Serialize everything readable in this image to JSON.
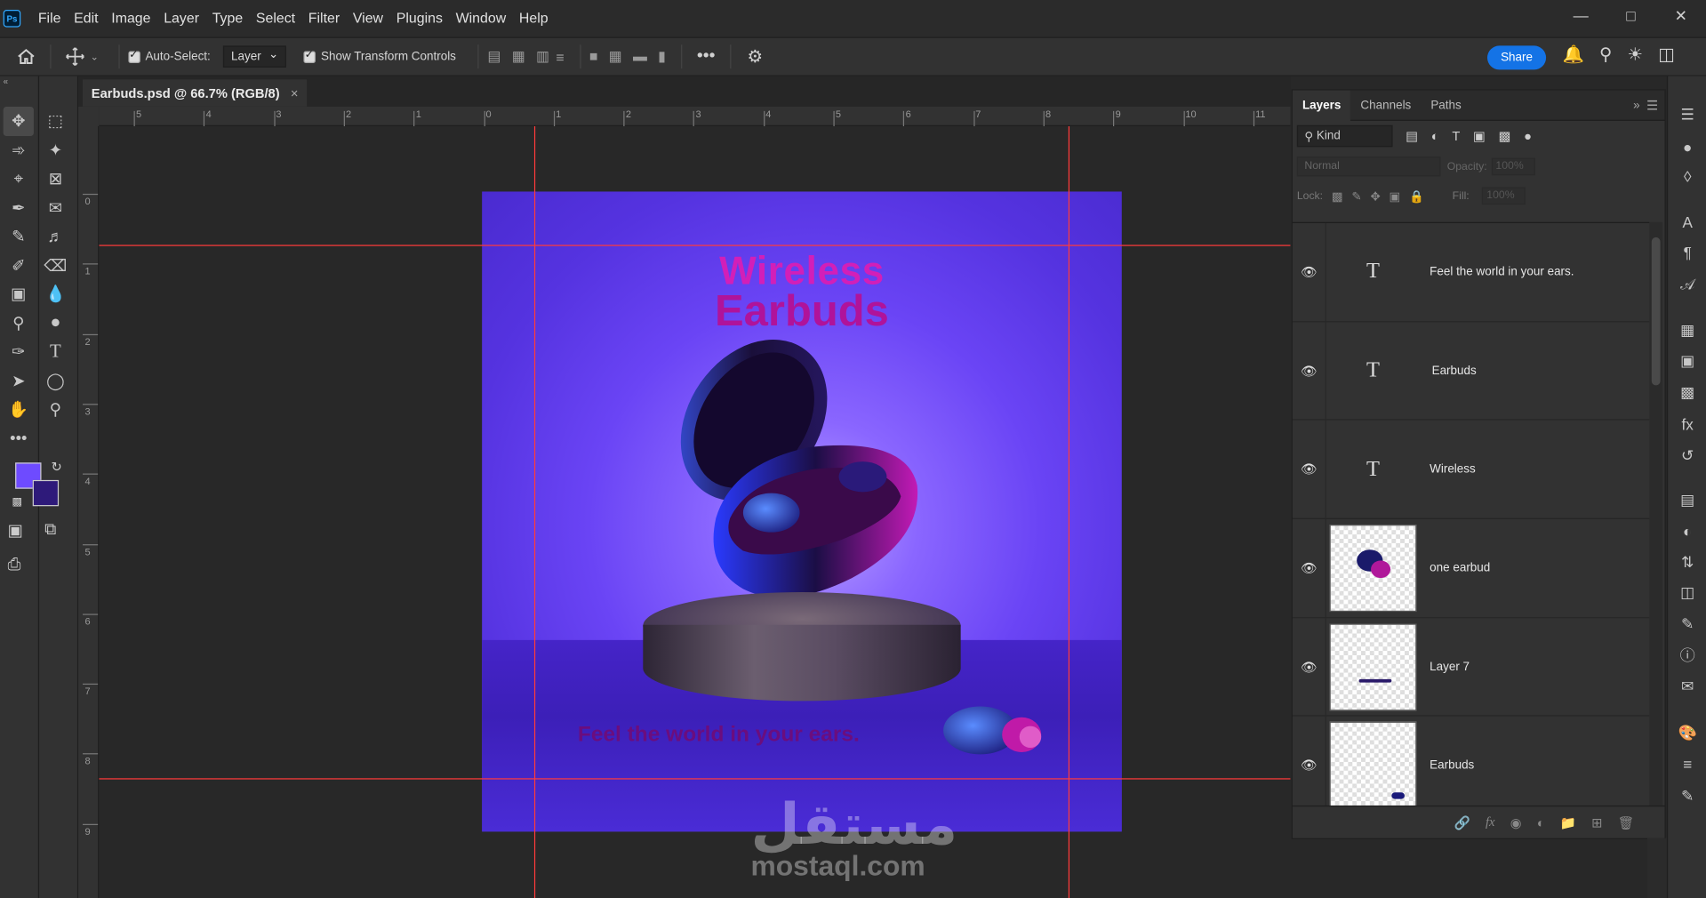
{
  "menubar": {
    "logo": "Ps",
    "items": [
      "File",
      "Edit",
      "Image",
      "Layer",
      "Type",
      "Select",
      "Filter",
      "View",
      "Plugins",
      "Window",
      "Help"
    ]
  },
  "options": {
    "auto_select_label": "Auto-Select:",
    "auto_select_value": "Layer",
    "show_transform_label": "Show Transform Controls",
    "share_label": "Share"
  },
  "document": {
    "tab_title": "Earbuds.psd @ 66.7% (RGB/8)",
    "close": "×"
  },
  "ruler": {
    "h_ticks": [
      "5",
      "4",
      "3",
      "2",
      "1",
      "0",
      "1",
      "2",
      "3",
      "4",
      "5",
      "6",
      "7",
      "8",
      "9",
      "10",
      "11"
    ],
    "v_ticks": [
      "0",
      "1",
      "2",
      "3",
      "4",
      "5",
      "6",
      "7",
      "8",
      "9"
    ]
  },
  "artwork": {
    "headline_line1": "Wireless",
    "headline_line2": "Earbuds",
    "tagline": "Feel the world in your ears."
  },
  "watermark": {
    "arabic": "مستقل",
    "latin": "mostaql.com"
  },
  "layers_panel": {
    "tabs": [
      "Layers",
      "Channels",
      "Paths"
    ],
    "kind_label": "Kind",
    "blend_mode": "Normal",
    "opacity_label": "Opacity:",
    "opacity_value": "100%",
    "lock_label": "Lock:",
    "fill_label": "Fill:",
    "fill_value": "100%",
    "layers": [
      {
        "name": "Feel the world in your ears.",
        "type": "text"
      },
      {
        "name": "Earbuds",
        "type": "text"
      },
      {
        "name": "Wireless",
        "type": "text"
      },
      {
        "name": "one earbud",
        "type": "image"
      },
      {
        "name": "Layer 7",
        "type": "image"
      },
      {
        "name": "Earbuds",
        "type": "image"
      }
    ]
  },
  "colors": {
    "foreground": "#6e4bff",
    "background": "#2e1a7a",
    "share_button": "#1473e6",
    "guide": "#ff3b3b",
    "headline": "#d21fb8"
  }
}
